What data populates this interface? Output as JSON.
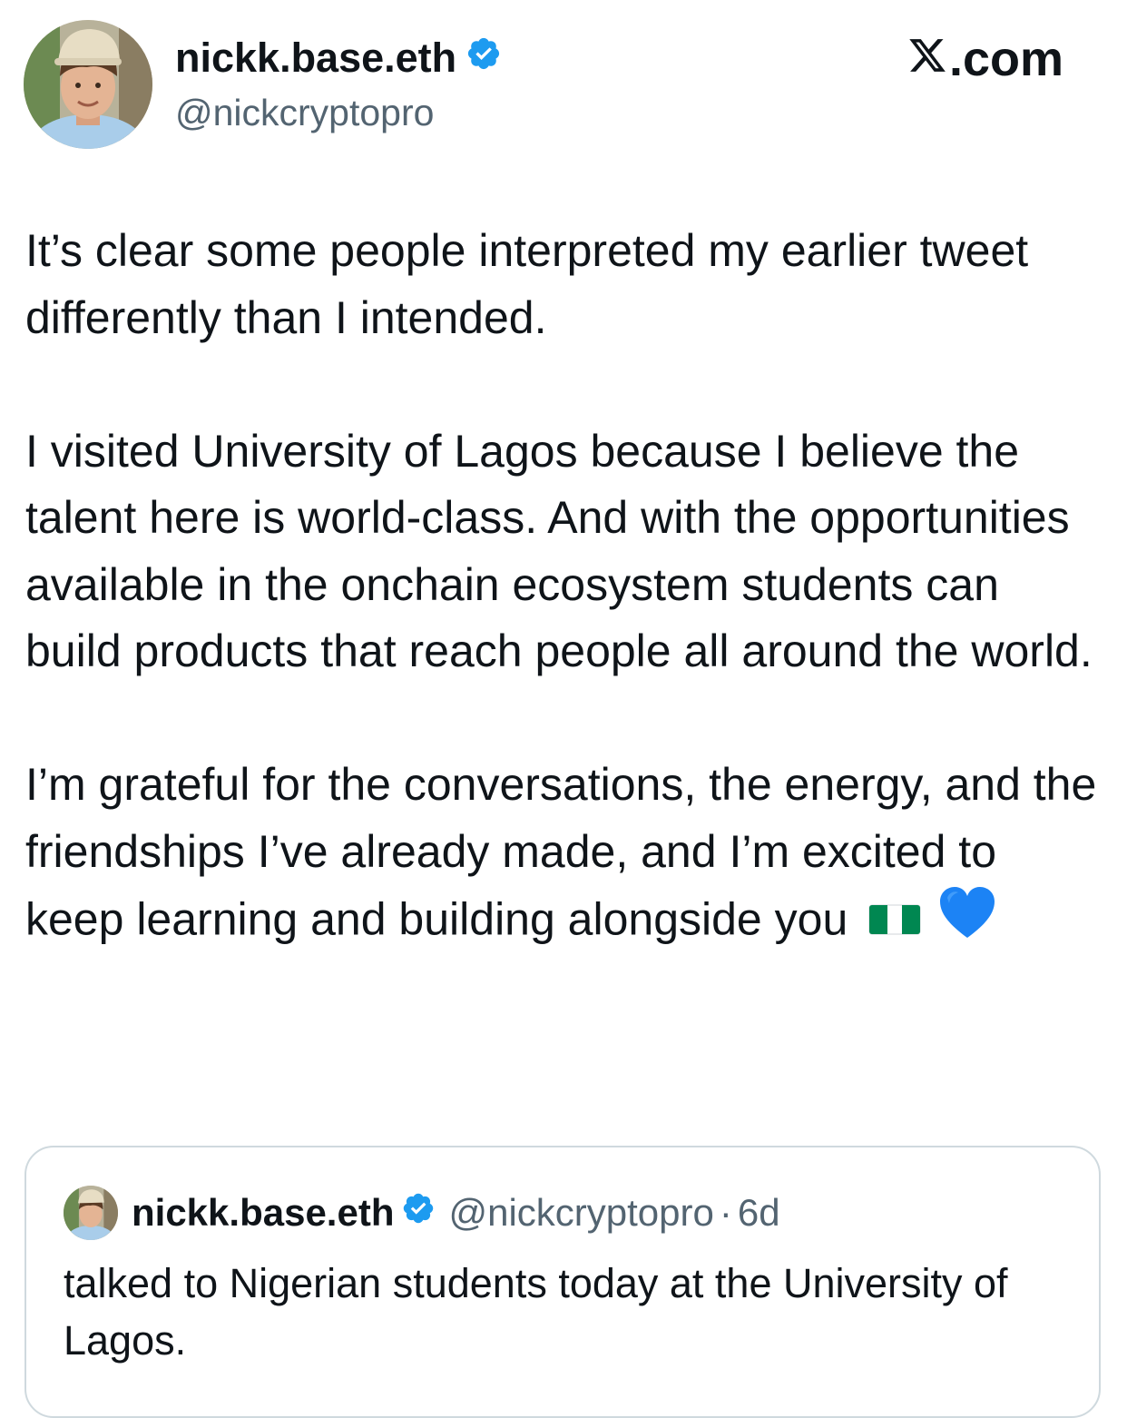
{
  "author": {
    "display_name": "nickk.base.eth",
    "handle": "@nickcryptopro",
    "verified": true,
    "avatar_icon": "profile-photo"
  },
  "brand": {
    "site": ".com",
    "logo_icon": "x-logo-icon"
  },
  "tweet": {
    "paragraphs": [
      "It’s clear some people interpreted my earlier tweet differently than I intended.",
      "I visited University of Lagos because I believe the talent here is world-class. And with the opportunities available in the onchain ecosystem students can build products that reach people all around the world.",
      "I’m grateful for the conversations, the energy, and the friendships I’ve already made, and I’m excited to keep learning and building alongside you"
    ],
    "emojis": [
      "nigeria-flag",
      "blue-heart"
    ]
  },
  "quoted_tweet": {
    "display_name": "nickk.base.eth",
    "handle": "@nickcryptopro",
    "separator": "·",
    "time": "6d",
    "text": "talked to Nigerian students today at the University of Lagos."
  },
  "colors": {
    "text": "#0f1419",
    "secondary": "#536471",
    "verified_blue": "#1d9bf0",
    "border": "#cfd9de",
    "flag_green": "#008751"
  }
}
